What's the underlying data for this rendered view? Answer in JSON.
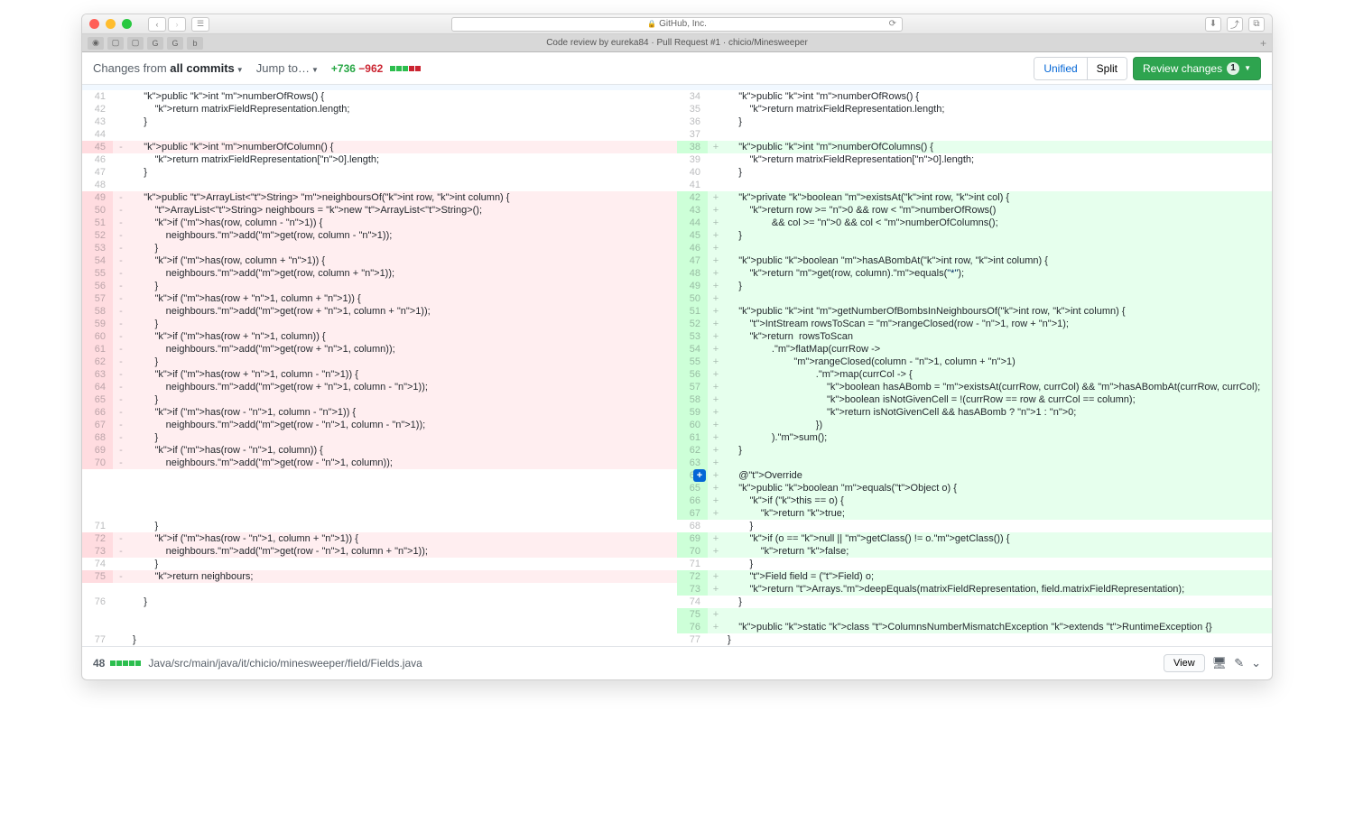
{
  "browser": {
    "domain": "GitHub, Inc.",
    "tab_title": "Code review by eureka84 · Pull Request #1 · chicio/Minesweeper"
  },
  "toolbar": {
    "changes_prefix": "Changes from ",
    "changes_bold": "all commits",
    "jump_to": "Jump to…",
    "additions": "+736",
    "deletions": "−962",
    "unified": "Unified",
    "split": "Split",
    "review_changes": "Review changes",
    "review_count": "1"
  },
  "file_header": {
    "count": "48",
    "path": "Java/src/main/java/it/chicio/minesweeper/field/Fields.java",
    "view": "View"
  },
  "left": [
    {
      "n": "41",
      "m": " ",
      "t": "ctx",
      "c": "    public int numberOfRows() {"
    },
    {
      "n": "42",
      "m": " ",
      "t": "ctx",
      "c": "        return matrixFieldRepresentation.length;"
    },
    {
      "n": "43",
      "m": " ",
      "t": "ctx",
      "c": "    }"
    },
    {
      "n": "44",
      "m": " ",
      "t": "ctx",
      "c": ""
    },
    {
      "n": "45",
      "m": "-",
      "t": "del",
      "c": "    public int numberOfColumn() {"
    },
    {
      "n": "46",
      "m": " ",
      "t": "ctx",
      "c": "        return matrixFieldRepresentation[0].length;"
    },
    {
      "n": "47",
      "m": " ",
      "t": "ctx",
      "c": "    }"
    },
    {
      "n": "48",
      "m": " ",
      "t": "ctx",
      "c": ""
    },
    {
      "n": "49",
      "m": "-",
      "t": "del",
      "c": "    public ArrayList<String> neighboursOf(int row, int column) {"
    },
    {
      "n": "50",
      "m": "-",
      "t": "del",
      "c": "        ArrayList<String> neighbours = new ArrayList<String>();"
    },
    {
      "n": "51",
      "m": "-",
      "t": "del",
      "c": "        if (has(row, column - 1)) {"
    },
    {
      "n": "52",
      "m": "-",
      "t": "del",
      "c": "            neighbours.add(get(row, column - 1));"
    },
    {
      "n": "53",
      "m": "-",
      "t": "del",
      "c": "        }"
    },
    {
      "n": "54",
      "m": "-",
      "t": "del",
      "c": "        if (has(row, column + 1)) {"
    },
    {
      "n": "55",
      "m": "-",
      "t": "del",
      "c": "            neighbours.add(get(row, column + 1));"
    },
    {
      "n": "56",
      "m": "-",
      "t": "del",
      "c": "        }"
    },
    {
      "n": "57",
      "m": "-",
      "t": "del",
      "c": "        if (has(row + 1, column + 1)) {"
    },
    {
      "n": "58",
      "m": "-",
      "t": "del",
      "c": "            neighbours.add(get(row + 1, column + 1));"
    },
    {
      "n": "59",
      "m": "-",
      "t": "del",
      "c": "        }"
    },
    {
      "n": "60",
      "m": "-",
      "t": "del",
      "c": "        if (has(row + 1, column)) {"
    },
    {
      "n": "61",
      "m": "-",
      "t": "del",
      "c": "            neighbours.add(get(row + 1, column));"
    },
    {
      "n": "62",
      "m": "-",
      "t": "del",
      "c": "        }"
    },
    {
      "n": "63",
      "m": "-",
      "t": "del",
      "c": "        if (has(row + 1, column - 1)) {"
    },
    {
      "n": "64",
      "m": "-",
      "t": "del",
      "c": "            neighbours.add(get(row + 1, column - 1));"
    },
    {
      "n": "65",
      "m": "-",
      "t": "del",
      "c": "        }"
    },
    {
      "n": "66",
      "m": "-",
      "t": "del",
      "c": "        if (has(row - 1, column - 1)) {"
    },
    {
      "n": "67",
      "m": "-",
      "t": "del",
      "c": "            neighbours.add(get(row - 1, column - 1));"
    },
    {
      "n": "68",
      "m": "-",
      "t": "del",
      "c": "        }"
    },
    {
      "n": "69",
      "m": "-",
      "t": "del",
      "c": "        if (has(row - 1, column)) {"
    },
    {
      "n": "70",
      "m": "-",
      "t": "del",
      "c": "            neighbours.add(get(row - 1, column));"
    },
    {
      "n": "",
      "m": "",
      "t": "ctx",
      "c": ""
    },
    {
      "n": "",
      "m": "",
      "t": "ctx",
      "c": ""
    },
    {
      "n": "",
      "m": "",
      "t": "ctx",
      "c": ""
    },
    {
      "n": "",
      "m": "",
      "t": "ctx",
      "c": ""
    },
    {
      "n": "71",
      "m": " ",
      "t": "ctx",
      "c": "        }"
    },
    {
      "n": "72",
      "m": "-",
      "t": "del",
      "c": "        if (has(row - 1, column + 1)) {"
    },
    {
      "n": "73",
      "m": "-",
      "t": "del",
      "c": "            neighbours.add(get(row - 1, column + 1));"
    },
    {
      "n": "74",
      "m": " ",
      "t": "ctx",
      "c": "        }"
    },
    {
      "n": "75",
      "m": "-",
      "t": "del",
      "c": "        return neighbours;"
    },
    {
      "n": "",
      "m": "",
      "t": "ctx",
      "c": ""
    },
    {
      "n": "76",
      "m": " ",
      "t": "ctx",
      "c": "    }"
    },
    {
      "n": "",
      "m": "",
      "t": "ctx",
      "c": ""
    },
    {
      "n": "",
      "m": "",
      "t": "ctx",
      "c": ""
    },
    {
      "n": "77",
      "m": " ",
      "t": "ctx",
      "c": "}"
    }
  ],
  "right": [
    {
      "n": "34",
      "m": " ",
      "t": "ctx",
      "c": "    public int numberOfRows() {"
    },
    {
      "n": "35",
      "m": " ",
      "t": "ctx",
      "c": "        return matrixFieldRepresentation.length;"
    },
    {
      "n": "36",
      "m": " ",
      "t": "ctx",
      "c": "    }"
    },
    {
      "n": "37",
      "m": " ",
      "t": "ctx",
      "c": ""
    },
    {
      "n": "38",
      "m": "+",
      "t": "add",
      "c": "    public int numberOfColumns() {"
    },
    {
      "n": "39",
      "m": " ",
      "t": "ctx",
      "c": "        return matrixFieldRepresentation[0].length;"
    },
    {
      "n": "40",
      "m": " ",
      "t": "ctx",
      "c": "    }"
    },
    {
      "n": "41",
      "m": " ",
      "t": "ctx",
      "c": ""
    },
    {
      "n": "42",
      "m": "+",
      "t": "add",
      "c": "    private boolean existsAt(int row, int col) {"
    },
    {
      "n": "43",
      "m": "+",
      "t": "add",
      "c": "        return row >= 0 && row < numberOfRows()"
    },
    {
      "n": "44",
      "m": "+",
      "t": "add",
      "c": "                && col >= 0 && col < numberOfColumns();"
    },
    {
      "n": "45",
      "m": "+",
      "t": "add",
      "c": "    }"
    },
    {
      "n": "46",
      "m": "+",
      "t": "add",
      "c": ""
    },
    {
      "n": "47",
      "m": "+",
      "t": "add",
      "c": "    public boolean hasABombAt(int row, int column) {"
    },
    {
      "n": "48",
      "m": "+",
      "t": "add",
      "c": "        return get(row, column).equals(\"*\");"
    },
    {
      "n": "49",
      "m": "+",
      "t": "add",
      "c": "    }"
    },
    {
      "n": "50",
      "m": "+",
      "t": "add",
      "c": ""
    },
    {
      "n": "51",
      "m": "+",
      "t": "add",
      "c": "    public int getNumberOfBombsInNeighboursOf(int row, int column) {"
    },
    {
      "n": "52",
      "m": "+",
      "t": "add",
      "c": "        IntStream rowsToScan = rangeClosed(row - 1, row + 1);"
    },
    {
      "n": "53",
      "m": "+",
      "t": "add",
      "c": "        return  rowsToScan"
    },
    {
      "n": "54",
      "m": "+",
      "t": "add",
      "c": "                .flatMap(currRow ->"
    },
    {
      "n": "55",
      "m": "+",
      "t": "add",
      "c": "                        rangeClosed(column - 1, column + 1)"
    },
    {
      "n": "56",
      "m": "+",
      "t": "add",
      "c": "                                .map(currCol -> {"
    },
    {
      "n": "57",
      "m": "+",
      "t": "add",
      "c": "                                    boolean hasABomb = existsAt(currRow, currCol) && hasABombAt(currRow, currCol);"
    },
    {
      "n": "58",
      "m": "+",
      "t": "add",
      "c": "                                    boolean isNotGivenCell = !(currRow == row & currCol == column);"
    },
    {
      "n": "59",
      "m": "+",
      "t": "add",
      "c": "                                    return isNotGivenCell && hasABomb ? 1 : 0;"
    },
    {
      "n": "60",
      "m": "+",
      "t": "add",
      "c": "                                })"
    },
    {
      "n": "61",
      "m": "+",
      "t": "add",
      "c": "                ).sum();"
    },
    {
      "n": "62",
      "m": "+",
      "t": "add",
      "c": "    }"
    },
    {
      "n": "63",
      "m": "+",
      "t": "add",
      "c": ""
    },
    {
      "n": "64",
      "m": "+",
      "t": "add",
      "c": "    @Override",
      "ac": true
    },
    {
      "n": "65",
      "m": "+",
      "t": "add",
      "c": "    public boolean equals(Object o) {"
    },
    {
      "n": "66",
      "m": "+",
      "t": "add",
      "c": "        if (this == o) {"
    },
    {
      "n": "67",
      "m": "+",
      "t": "add",
      "c": "            return true;"
    },
    {
      "n": "68",
      "m": " ",
      "t": "ctx",
      "c": "        }"
    },
    {
      "n": "69",
      "m": "+",
      "t": "add",
      "c": "        if (o == null || getClass() != o.getClass()) {"
    },
    {
      "n": "70",
      "m": "+",
      "t": "add",
      "c": "            return false;"
    },
    {
      "n": "71",
      "m": " ",
      "t": "ctx",
      "c": "        }"
    },
    {
      "n": "72",
      "m": "+",
      "t": "add",
      "c": "        Field field = (Field) o;"
    },
    {
      "n": "73",
      "m": "+",
      "t": "add",
      "c": "        return Arrays.deepEquals(matrixFieldRepresentation, field.matrixFieldRepresentation);"
    },
    {
      "n": "74",
      "m": " ",
      "t": "ctx",
      "c": "    }"
    },
    {
      "n": "75",
      "m": "+",
      "t": "add",
      "c": ""
    },
    {
      "n": "76",
      "m": "+",
      "t": "add",
      "c": "    public static class ColumnsNumberMismatchException extends RuntimeException {}"
    },
    {
      "n": "77",
      "m": " ",
      "t": "ctx",
      "c": "}"
    }
  ]
}
